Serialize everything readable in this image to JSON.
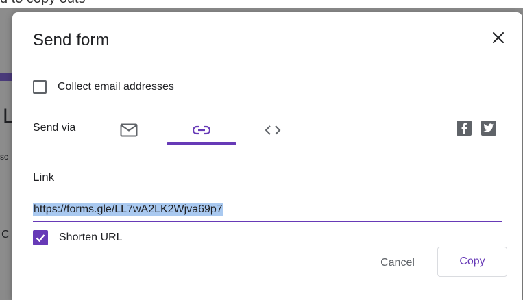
{
  "background": {
    "top_text": "d to copy outs",
    "left_fragments": [
      "L",
      "sc",
      "C"
    ]
  },
  "dialog": {
    "title": "Send form",
    "collect_email_label": "Collect email addresses",
    "collect_email_checked": false,
    "send_via_label": "Send via",
    "tabs": [
      {
        "name": "email",
        "icon": "mail-icon",
        "selected": false
      },
      {
        "name": "link",
        "icon": "link-icon",
        "selected": true
      },
      {
        "name": "embed",
        "icon": "code-icon",
        "selected": false
      }
    ],
    "social": [
      "facebook-icon",
      "twitter-icon"
    ],
    "link_label": "Link",
    "url_value": "https://forms.gle/LL7wA2LK2Wjva69p7",
    "shorten_label": "Shorten URL",
    "shorten_checked": true,
    "cancel_label": "Cancel",
    "copy_label": "Copy"
  },
  "colors": {
    "accent": "#673ab7",
    "selection": "#a9c9f0",
    "icon_gray": "#5f6368"
  }
}
